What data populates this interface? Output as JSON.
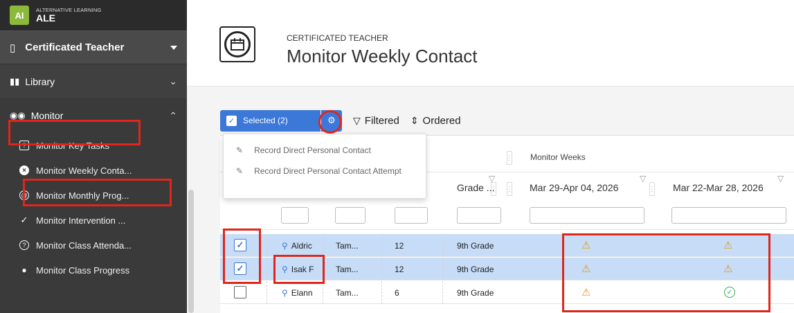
{
  "brand": {
    "logo": "AI",
    "subtitle": "ALTERNATIVE LEARNING",
    "name": "ALE"
  },
  "sidebar": {
    "section": "Certificated Teacher",
    "library": "Library",
    "monitor": "Monitor",
    "items": [
      {
        "label": "Monitor Key Tasks",
        "icon": "question-square-icon"
      },
      {
        "label": "Monitor Weekly Conta...",
        "icon": "x-circle-icon"
      },
      {
        "label": "Monitor Monthly Prog...",
        "icon": "at-circle-icon"
      },
      {
        "label": "Monitor Intervention ...",
        "icon": "check-icon"
      },
      {
        "label": "Monitor Class Attenda...",
        "icon": "question-circle-icon"
      },
      {
        "label": "Monitor Class Progress",
        "icon": "people-icon"
      }
    ]
  },
  "header": {
    "subtitle": "CERTIFICATED TEACHER",
    "title": "Monitor Weekly Contact"
  },
  "toolbar": {
    "selected": "Selected (2)",
    "filtered": "Filtered",
    "ordered": "Ordered"
  },
  "menu": {
    "items": [
      "Record Direct Personal Contact",
      "Record Direct Personal Contact Attempt"
    ]
  },
  "grid": {
    "group_header": "Monitor Weeks",
    "columns": {
      "grade": "Grade ...",
      "week1": "Mar 29-Apr 04, 2026",
      "week2": "Mar 22-Mar 28, 2026"
    },
    "rows": [
      {
        "selected": true,
        "name": "Aldric",
        "teacher": "Tam...",
        "age": "12",
        "grade": "9th Grade",
        "w1": "warning",
        "w2": "warning"
      },
      {
        "selected": true,
        "name": "Isak F",
        "teacher": "Tam...",
        "age": "12",
        "grade": "9th Grade",
        "w1": "warning",
        "w2": "warning"
      },
      {
        "selected": false,
        "name": "Elann",
        "teacher": "Tam...",
        "age": "6",
        "grade": "9th Grade",
        "w1": "warning",
        "w2": "ok"
      }
    ]
  },
  "colors": {
    "accent": "#3c78d8",
    "annotation": "#e0261b",
    "warning": "#e29a1a",
    "ok": "#34a853"
  }
}
